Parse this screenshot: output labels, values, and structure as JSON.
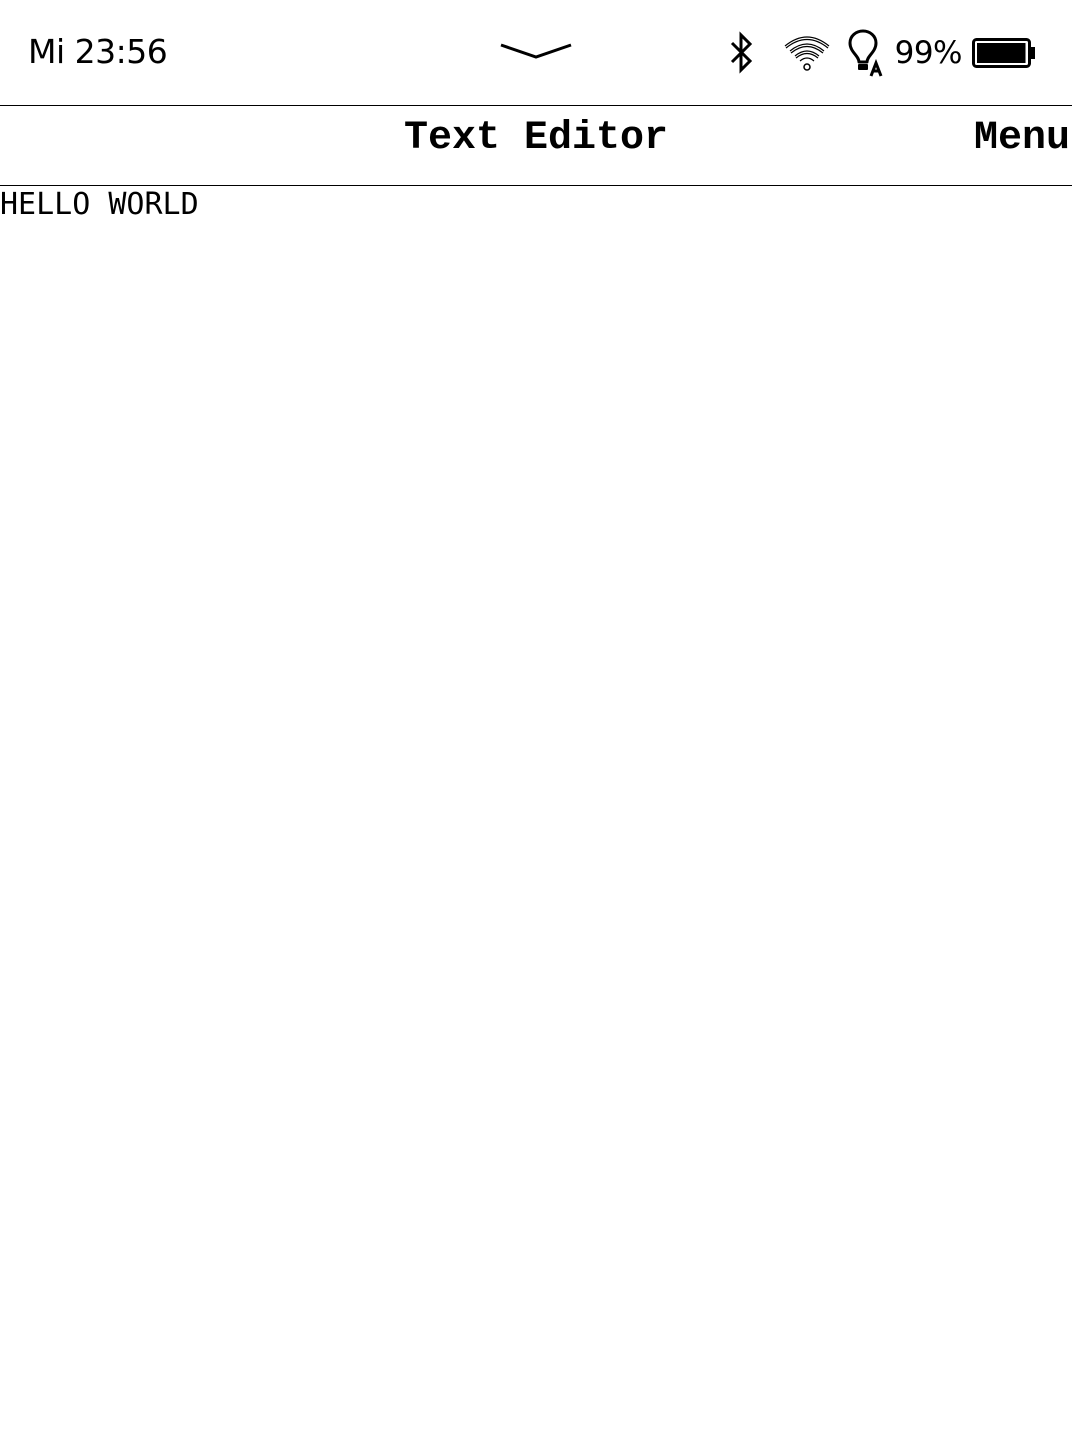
{
  "status_bar": {
    "time": "Mi 23:56",
    "battery_percent": "99%",
    "battery_level": 0.99,
    "icons": [
      "pulldown-chevron-icon",
      "bluetooth-icon",
      "wifi-icon",
      "frontlight-auto-icon",
      "battery-icon"
    ]
  },
  "header": {
    "title": "Text Editor",
    "menu_label": "Menu"
  },
  "editor": {
    "content": "HELLO WORLD"
  },
  "colors": {
    "foreground": "#000000",
    "background": "#ffffff"
  }
}
